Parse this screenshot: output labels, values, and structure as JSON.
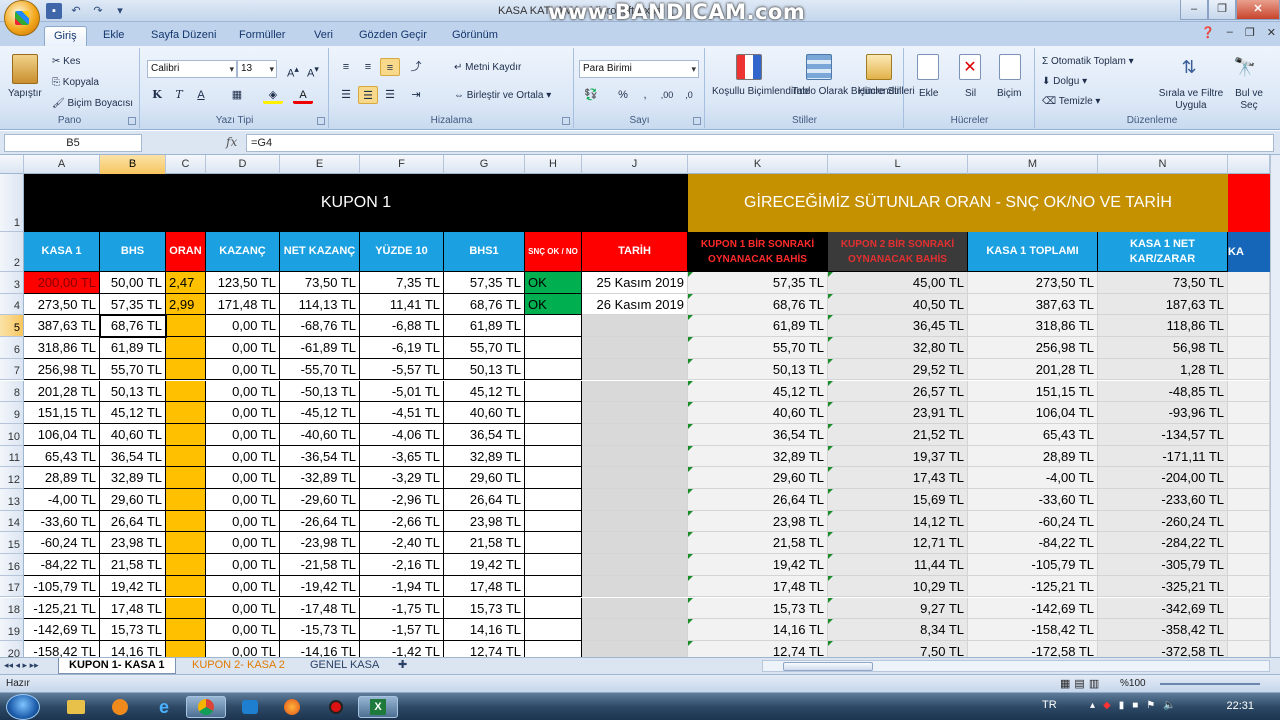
{
  "window": {
    "title": "KASA KATLAMA - Microsoft Excel",
    "overlay_watermark": "www.BANDICAM.com"
  },
  "ribbon_tabs": [
    "Giriş",
    "Ekle",
    "Sayfa Düzeni",
    "Formüller",
    "Veri",
    "Gözden Geçir",
    "Görünüm"
  ],
  "ribbon": {
    "pano": {
      "paste": "Yapıştır",
      "cut": "Kes",
      "copy": "Kopyala",
      "format_painter": "Biçim Boyacısı",
      "label": "Pano"
    },
    "font": {
      "name": "Calibri",
      "size": "13",
      "label": "Yazı Tipi",
      "bold": "K",
      "italic": "T",
      "underline": "A"
    },
    "alignment": {
      "wrap": "Metni Kaydır",
      "merge": "Birleştir ve Ortala",
      "label": "Hizalama"
    },
    "number": {
      "format": "Para Birimi",
      "percent": "%",
      "label": "Sayı"
    },
    "styles": {
      "conditional": "Koşullu Biçimlendirme",
      "table": "Tablo Olarak Biçimlendir",
      "cell": "Hücre Stilleri",
      "label": "Stiller"
    },
    "cells": {
      "insert": "Ekle",
      "delete": "Sil",
      "format": "Biçim",
      "label": "Hücreler"
    },
    "editing": {
      "autosum": "Otomatik Toplam",
      "fill": "Dolgu",
      "clear": "Temizle",
      "sort": "Sırala ve Filtre Uygula",
      "find": "Bul ve Seç",
      "label": "Düzenleme"
    }
  },
  "formula_bar": {
    "name_box": "B5",
    "fx": "fx",
    "formula": "=G4"
  },
  "columns": [
    "A",
    "B",
    "C",
    "D",
    "E",
    "F",
    "G",
    "H",
    "J",
    "K",
    "L",
    "M",
    "N"
  ],
  "row_numbers": [
    "1",
    "2",
    "3",
    "4",
    "5",
    "6",
    "7",
    "8",
    "9",
    "10",
    "11",
    "12",
    "13",
    "14",
    "15",
    "16",
    "17",
    "18",
    "19",
    "20"
  ],
  "headers": {
    "kupon1": "KUPON 1",
    "gireceğimiz": "GİRECEĞİMİZ SÜTUNLAR ORAN - SNÇ OK/NO VE TARİH",
    "kasa1": "KASA 1",
    "bhs": "BHS",
    "oran": "ORAN",
    "kazanc": "KAZANÇ",
    "net_kazanc": "NET KAZANÇ",
    "yuzde10": "YÜZDE 10",
    "bhs1": "BHS1",
    "snc": "SNÇ OK / NO",
    "tarih": "TARİH",
    "kupon1_next": "KUPON 1 BİR SONRAKİ OYNANACAK BAHİS",
    "kupon2_next": "KUPON 2 BİR SONRAKİ OYNANACAK BAHİS",
    "kasa1_toplam": "KASA 1 TOPLAMI",
    "kasa1_net": "KASA 1 NET KAR/ZARAR",
    "extra": "KA"
  },
  "rows": [
    {
      "a": "200,00 TL",
      "b": "50,00 TL",
      "c": "2,47",
      "d": "123,50 TL",
      "e": "73,50 TL",
      "f": "7,35 TL",
      "g": "57,35 TL",
      "h": "OK",
      "j": "25 Kasım 2019",
      "k": "57,35 TL",
      "l": "45,00 TL",
      "m": "273,50 TL",
      "n": "73,50 TL"
    },
    {
      "a": "273,50 TL",
      "b": "57,35 TL",
      "c": "2,99",
      "d": "171,48 TL",
      "e": "114,13 TL",
      "f": "11,41 TL",
      "g": "68,76 TL",
      "h": "OK",
      "j": "26 Kasım 2019",
      "k": "68,76 TL",
      "l": "40,50 TL",
      "m": "387,63 TL",
      "n": "187,63 TL"
    },
    {
      "a": "387,63 TL",
      "b": "68,76 TL",
      "c": "",
      "d": "0,00 TL",
      "e": "-68,76 TL",
      "f": "-6,88 TL",
      "g": "61,89 TL",
      "h": "",
      "j": "",
      "k": "61,89 TL",
      "l": "36,45 TL",
      "m": "318,86 TL",
      "n": "118,86 TL"
    },
    {
      "a": "318,86 TL",
      "b": "61,89 TL",
      "c": "",
      "d": "0,00 TL",
      "e": "-61,89 TL",
      "f": "-6,19 TL",
      "g": "55,70 TL",
      "h": "",
      "j": "",
      "k": "55,70 TL",
      "l": "32,80 TL",
      "m": "256,98 TL",
      "n": "56,98 TL"
    },
    {
      "a": "256,98 TL",
      "b": "55,70 TL",
      "c": "",
      "d": "0,00 TL",
      "e": "-55,70 TL",
      "f": "-5,57 TL",
      "g": "50,13 TL",
      "h": "",
      "j": "",
      "k": "50,13 TL",
      "l": "29,52 TL",
      "m": "201,28 TL",
      "n": "1,28 TL"
    },
    {
      "a": "201,28 TL",
      "b": "50,13 TL",
      "c": "",
      "d": "0,00 TL",
      "e": "-50,13 TL",
      "f": "-5,01 TL",
      "g": "45,12 TL",
      "h": "",
      "j": "",
      "k": "45,12 TL",
      "l": "26,57 TL",
      "m": "151,15 TL",
      "n": "-48,85 TL"
    },
    {
      "a": "151,15 TL",
      "b": "45,12 TL",
      "c": "",
      "d": "0,00 TL",
      "e": "-45,12 TL",
      "f": "-4,51 TL",
      "g": "40,60 TL",
      "h": "",
      "j": "",
      "k": "40,60 TL",
      "l": "23,91 TL",
      "m": "106,04 TL",
      "n": "-93,96 TL"
    },
    {
      "a": "106,04 TL",
      "b": "40,60 TL",
      "c": "",
      "d": "0,00 TL",
      "e": "-40,60 TL",
      "f": "-4,06 TL",
      "g": "36,54 TL",
      "h": "",
      "j": "",
      "k": "36,54 TL",
      "l": "21,52 TL",
      "m": "65,43 TL",
      "n": "-134,57 TL"
    },
    {
      "a": "65,43 TL",
      "b": "36,54 TL",
      "c": "",
      "d": "0,00 TL",
      "e": "-36,54 TL",
      "f": "-3,65 TL",
      "g": "32,89 TL",
      "h": "",
      "j": "",
      "k": "32,89 TL",
      "l": "19,37 TL",
      "m": "28,89 TL",
      "n": "-171,11 TL"
    },
    {
      "a": "28,89 TL",
      "b": "32,89 TL",
      "c": "",
      "d": "0,00 TL",
      "e": "-32,89 TL",
      "f": "-3,29 TL",
      "g": "29,60 TL",
      "h": "",
      "j": "",
      "k": "29,60 TL",
      "l": "17,43 TL",
      "m": "-4,00 TL",
      "n": "-204,00 TL"
    },
    {
      "a": "-4,00 TL",
      "b": "29,60 TL",
      "c": "",
      "d": "0,00 TL",
      "e": "-29,60 TL",
      "f": "-2,96 TL",
      "g": "26,64 TL",
      "h": "",
      "j": "",
      "k": "26,64 TL",
      "l": "15,69 TL",
      "m": "-33,60 TL",
      "n": "-233,60 TL"
    },
    {
      "a": "-33,60 TL",
      "b": "26,64 TL",
      "c": "",
      "d": "0,00 TL",
      "e": "-26,64 TL",
      "f": "-2,66 TL",
      "g": "23,98 TL",
      "h": "",
      "j": "",
      "k": "23,98 TL",
      "l": "14,12 TL",
      "m": "-60,24 TL",
      "n": "-260,24 TL"
    },
    {
      "a": "-60,24 TL",
      "b": "23,98 TL",
      "c": "",
      "d": "0,00 TL",
      "e": "-23,98 TL",
      "f": "-2,40 TL",
      "g": "21,58 TL",
      "h": "",
      "j": "",
      "k": "21,58 TL",
      "l": "12,71 TL",
      "m": "-84,22 TL",
      "n": "-284,22 TL"
    },
    {
      "a": "-84,22 TL",
      "b": "21,58 TL",
      "c": "",
      "d": "0,00 TL",
      "e": "-21,58 TL",
      "f": "-2,16 TL",
      "g": "19,42 TL",
      "h": "",
      "j": "",
      "k": "19,42 TL",
      "l": "11,44 TL",
      "m": "-105,79 TL",
      "n": "-305,79 TL"
    },
    {
      "a": "-105,79 TL",
      "b": "19,42 TL",
      "c": "",
      "d": "0,00 TL",
      "e": "-19,42 TL",
      "f": "-1,94 TL",
      "g": "17,48 TL",
      "h": "",
      "j": "",
      "k": "17,48 TL",
      "l": "10,29 TL",
      "m": "-125,21 TL",
      "n": "-325,21 TL"
    },
    {
      "a": "-125,21 TL",
      "b": "17,48 TL",
      "c": "",
      "d": "0,00 TL",
      "e": "-17,48 TL",
      "f": "-1,75 TL",
      "g": "15,73 TL",
      "h": "",
      "j": "",
      "k": "15,73 TL",
      "l": "9,27 TL",
      "m": "-142,69 TL",
      "n": "-342,69 TL"
    },
    {
      "a": "-142,69 TL",
      "b": "15,73 TL",
      "c": "",
      "d": "0,00 TL",
      "e": "-15,73 TL",
      "f": "-1,57 TL",
      "g": "14,16 TL",
      "h": "",
      "j": "",
      "k": "14,16 TL",
      "l": "8,34 TL",
      "m": "-158,42 TL",
      "n": "-358,42 TL"
    },
    {
      "a": "-158,42 TL",
      "b": "14,16 TL",
      "c": "",
      "d": "0,00 TL",
      "e": "-14,16 TL",
      "f": "-1,42 TL",
      "g": "12,74 TL",
      "h": "",
      "j": "",
      "k": "12,74 TL",
      "l": "7,50 TL",
      "m": "-172,58 TL",
      "n": "-372,58 TL"
    }
  ],
  "sheet_tabs": [
    "KUPON 1- KASA 1",
    "KUPON 2- KASA 2",
    "GENEL KASA"
  ],
  "status": {
    "ready": "Hazır",
    "zoom": "%100"
  },
  "taskbar": {
    "lang": "TR",
    "clock": "22:31"
  },
  "colors": {
    "black_band": "#000000",
    "gold_band": "#c59100",
    "header_blue": "#1ba1e2",
    "header_red": "#ff0000",
    "oran_orange": "#ffc000",
    "ok_green": "#00b050",
    "gray_band": "#d9d9d9"
  }
}
